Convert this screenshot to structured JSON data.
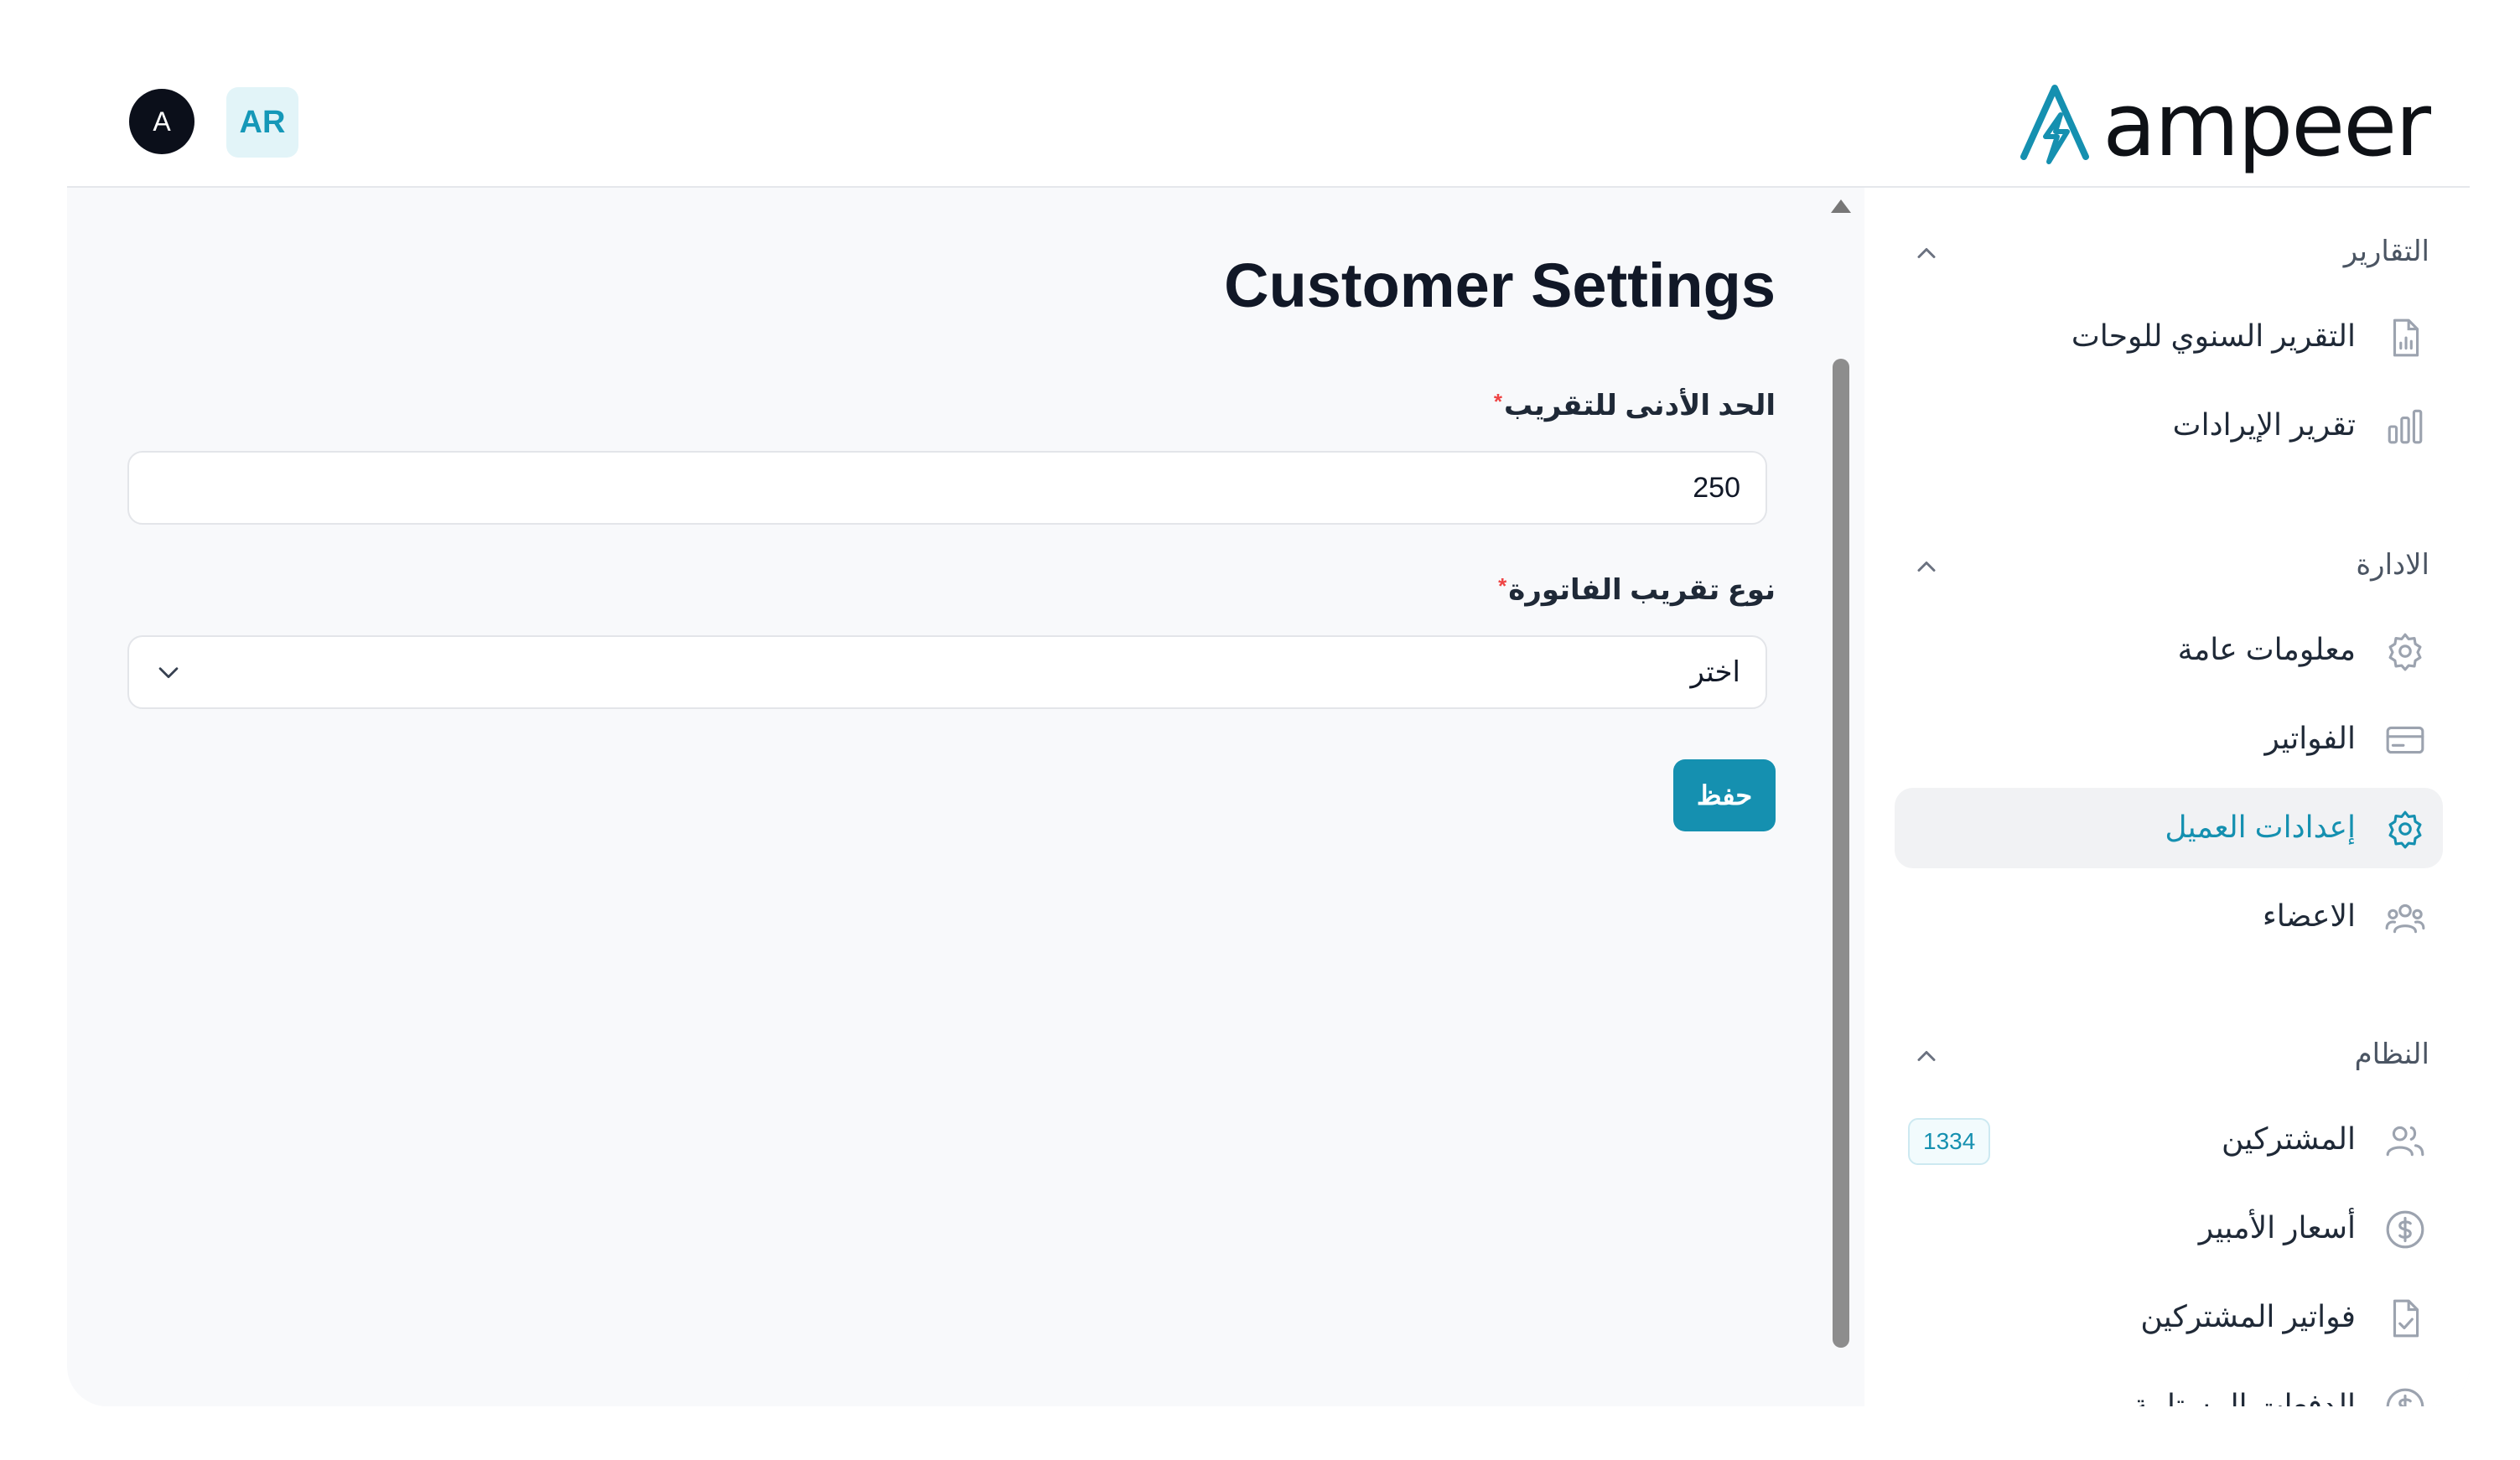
{
  "header": {
    "avatar_initial": "A",
    "lang_button": "AR",
    "logo_text": "ampeer"
  },
  "page": {
    "title": "Customer Settings",
    "fields": {
      "min_rounding": {
        "label": "الحد الأدنى للتقريب",
        "required_mark": "*",
        "value": "250"
      },
      "rounding_type": {
        "label": "نوع تقريب الفاتورة",
        "required_mark": "*",
        "selected": "اختر"
      }
    },
    "save_label": "حفظ"
  },
  "sidebar": {
    "sections": [
      {
        "title": "التقارير",
        "items": [
          {
            "label": "التقرير السنوي للوحات",
            "icon": "file-chart-icon"
          },
          {
            "label": "تقرير الإيرادات",
            "icon": "bar-chart-icon"
          }
        ]
      },
      {
        "title": "الادارة",
        "items": [
          {
            "label": "معلومات عامة",
            "icon": "gear-icon"
          },
          {
            "label": "الفواتير",
            "icon": "credit-card-icon"
          },
          {
            "label": "إعدادات العميل",
            "icon": "gear-icon",
            "active": true
          },
          {
            "label": "الاعضاء",
            "icon": "users-icon"
          }
        ]
      },
      {
        "title": "النظام",
        "items": [
          {
            "label": "المشتركين",
            "icon": "users-icon",
            "badge": "1334"
          },
          {
            "label": "أسعار الأمبير",
            "icon": "dollar-circle-icon"
          },
          {
            "label": "فواتير المشتركين",
            "icon": "file-check-icon"
          },
          {
            "label": "الدفعات المستلمة",
            "icon": "dollar-circle-icon"
          }
        ]
      }
    ]
  },
  "colors": {
    "accent": "#1590b0",
    "required": "#ef4444",
    "panel_bg": "#f8f9fb"
  }
}
